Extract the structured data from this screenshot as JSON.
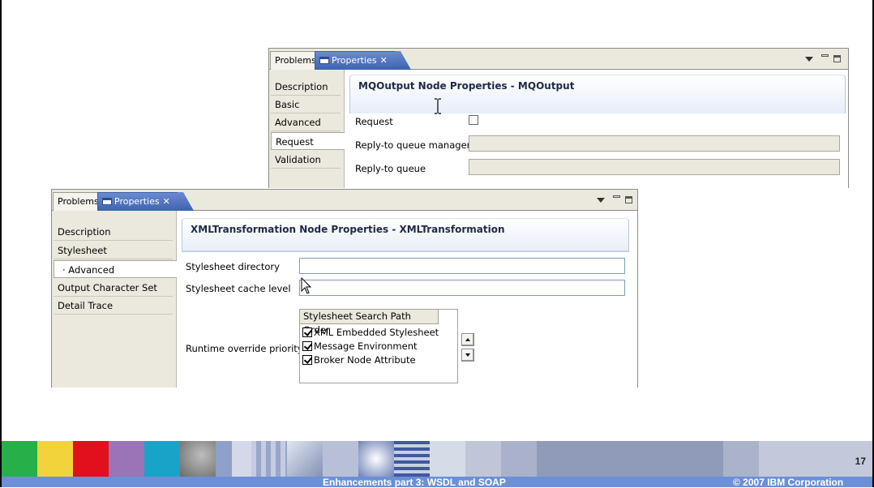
{
  "mq_view": {
    "tabs": {
      "problems": "Problems",
      "properties": "Properties",
      "close": "✕"
    },
    "sidebar": [
      "Description",
      "Basic",
      "Advanced",
      "Request",
      "Validation"
    ],
    "selected": "Request",
    "header": "MQOutput Node Properties - MQOutput",
    "fields": {
      "request_label": "Request",
      "reply_qmgr_label": "Reply-to queue manager",
      "reply_queue_label": "Reply-to queue",
      "reply_qmgr_value": "",
      "reply_queue_value": ""
    }
  },
  "xml_view": {
    "tabs": {
      "problems": "Problems",
      "properties": "Properties",
      "close": "✕"
    },
    "sidebar": [
      "Description",
      "Stylesheet",
      "· Advanced",
      "Output Character Set",
      "Detail Trace"
    ],
    "selected": "· Advanced",
    "header": "XMLTransformation Node Properties - XMLTransformation",
    "fields": {
      "dir_label": "Stylesheet directory",
      "cache_label": "Stylesheet cache level",
      "priority_label": "Runtime override priority",
      "dir_value": "",
      "cache_value": ""
    },
    "table": {
      "header": "Stylesheet Search Path Order",
      "rows": [
        "XML Embedded Stylesheet",
        "Message Environment",
        "Broker Node Attribute"
      ]
    }
  },
  "footer": {
    "page": "17",
    "title": "Enhancements part 3: WSDL and SOAP",
    "copyright": "© 2007 IBM Corporation"
  },
  "colors": {
    "tab_active": "#3d63b0",
    "footer_bar": "#6c8fd6"
  }
}
